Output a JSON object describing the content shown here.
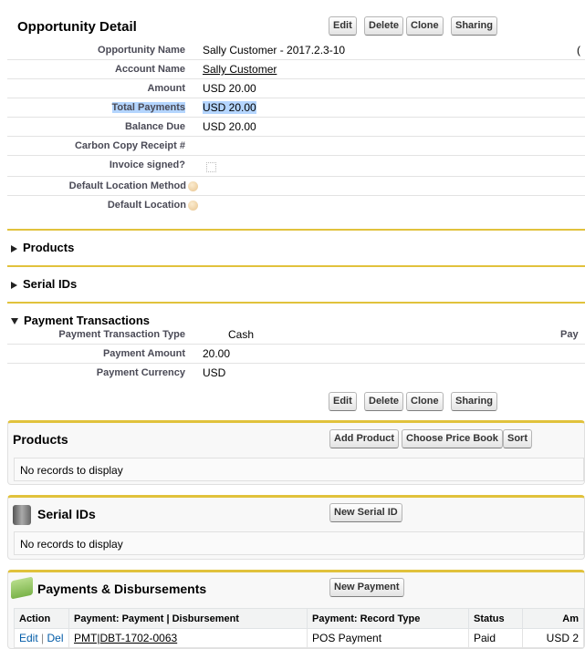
{
  "detail": {
    "title": "Opportunity Detail",
    "buttons": [
      "Edit",
      "Delete",
      "Clone",
      "Sharing"
    ],
    "fields": [
      {
        "label": "Opportunity Name",
        "value": "Sally Customer - 2017.2.3-10"
      },
      {
        "label": "Account Name",
        "value": "Sally Customer"
      },
      {
        "label": "Amount",
        "value": "USD 20.00"
      },
      {
        "label": "Total Payments",
        "value": "USD 20.00"
      },
      {
        "label": "Balance Due",
        "value": "USD 20.00"
      },
      {
        "label": "Carbon Copy Receipt #",
        "value": ""
      },
      {
        "label": "Invoice signed?",
        "value": ""
      },
      {
        "label": "Default Location Method",
        "value": ""
      },
      {
        "label": "Default Location",
        "value": ""
      }
    ],
    "right_cut": "("
  },
  "sections": {
    "products": "Products",
    "serial_ids": "Serial IDs",
    "payment_transactions": "Payment Transactions"
  },
  "payment_fields": [
    {
      "label": "Payment Transaction Type",
      "value": "Cash"
    },
    {
      "label": "Payment Amount",
      "value": "20.00"
    },
    {
      "label": "Payment Currency",
      "value": "USD"
    }
  ],
  "payment_right_cut": "Pay",
  "bottom_buttons": [
    "Edit",
    "Delete",
    "Clone",
    "Sharing"
  ],
  "related": {
    "products": {
      "title": "Products",
      "buttons": [
        "Add Product",
        "Choose Price Book",
        "Sort"
      ],
      "empty": "No records to display"
    },
    "serial_ids": {
      "title": "Serial IDs",
      "button": "New Serial ID",
      "empty": "No records to display"
    },
    "payments": {
      "title": "Payments & Disbursements",
      "button": "New Payment",
      "columns": [
        "Action",
        "Payment: Payment | Disbursement",
        "Payment: Record Type",
        "Status",
        "Am"
      ],
      "rows": [
        {
          "edit": "Edit",
          "sep": "|",
          "del": "Del",
          "name": "PMT|DBT-1702-0063",
          "type": "POS Payment",
          "status": "Paid",
          "amount": "USD 2"
        }
      ]
    }
  }
}
